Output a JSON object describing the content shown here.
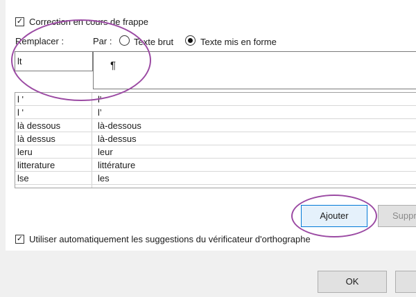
{
  "autocorrect": {
    "correct_as_you_type_label": "Correction en cours de frappe",
    "replace_label": "Remplacer :",
    "with_label": "Par :",
    "radio_plain": "Texte brut",
    "radio_formatted": "Texte mis en forme",
    "replace_value": "lt",
    "with_value": "¶",
    "entries": [
      {
        "from": "l '",
        "to": "l'"
      },
      {
        "from": "l '",
        "to": "l’"
      },
      {
        "from": "là dessous",
        "to": "là-dessous"
      },
      {
        "from": "là dessus",
        "to": "là-dessus"
      },
      {
        "from": "leru",
        "to": "leur"
      },
      {
        "from": "litterature",
        "to": "littérature"
      },
      {
        "from": "lse",
        "to": "les"
      }
    ],
    "add_button": "Ajouter",
    "delete_button": "Suppr",
    "use_suggestions_label": "Utiliser automatiquement les suggestions du vérificateur d'orthographe"
  },
  "footer": {
    "ok_button": "OK"
  },
  "colors": {
    "annotation": "#9b4aa3",
    "add_button_bg": "#e5f1fb",
    "add_button_border": "#0078d7"
  }
}
